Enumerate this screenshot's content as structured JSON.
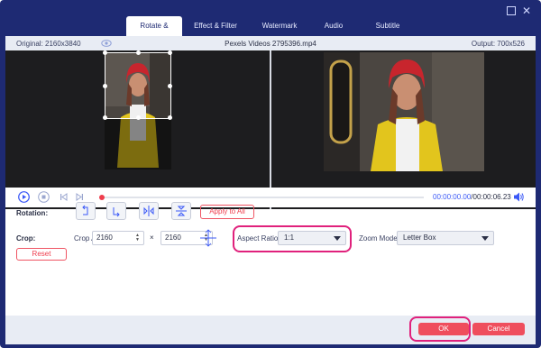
{
  "window": {
    "minimize_icon": "maximize-square-icon",
    "close_icon": "close-icon",
    "close_glyph": "✕"
  },
  "tabs": [
    {
      "label": "Rotate & Crop",
      "active": true
    },
    {
      "label": "Effect & Filter",
      "active": false
    },
    {
      "label": "Watermark",
      "active": false
    },
    {
      "label": "Audio",
      "active": false
    },
    {
      "label": "Subtitle",
      "active": false
    }
  ],
  "info": {
    "original": "Original: 2160x3840",
    "filename": "Pexels Videos 2795396.mp4",
    "output": "Output: 700x526"
  },
  "player": {
    "current_time": "00:00:00.00",
    "total_time": "/00:00:06.23",
    "progress": 0.0
  },
  "rotation": {
    "label": "Rotation:",
    "apply_all": "Apply to All"
  },
  "crop": {
    "label": "Crop:",
    "area_label": "Crop Area:",
    "width": "2160",
    "height": "2160",
    "times": "×",
    "aspect_label": "Aspect Ratio:",
    "aspect_value": "1:1",
    "zoom_label": "Zoom Mode:",
    "zoom_value": "Letter Box",
    "reset": "Reset"
  },
  "footer": {
    "ok": "OK",
    "cancel": "Cancel"
  },
  "colors": {
    "frame": "#1e2a73",
    "accent": "#ef4e5d",
    "highlight": "#e0217c",
    "timecode": "#3b59f7"
  }
}
